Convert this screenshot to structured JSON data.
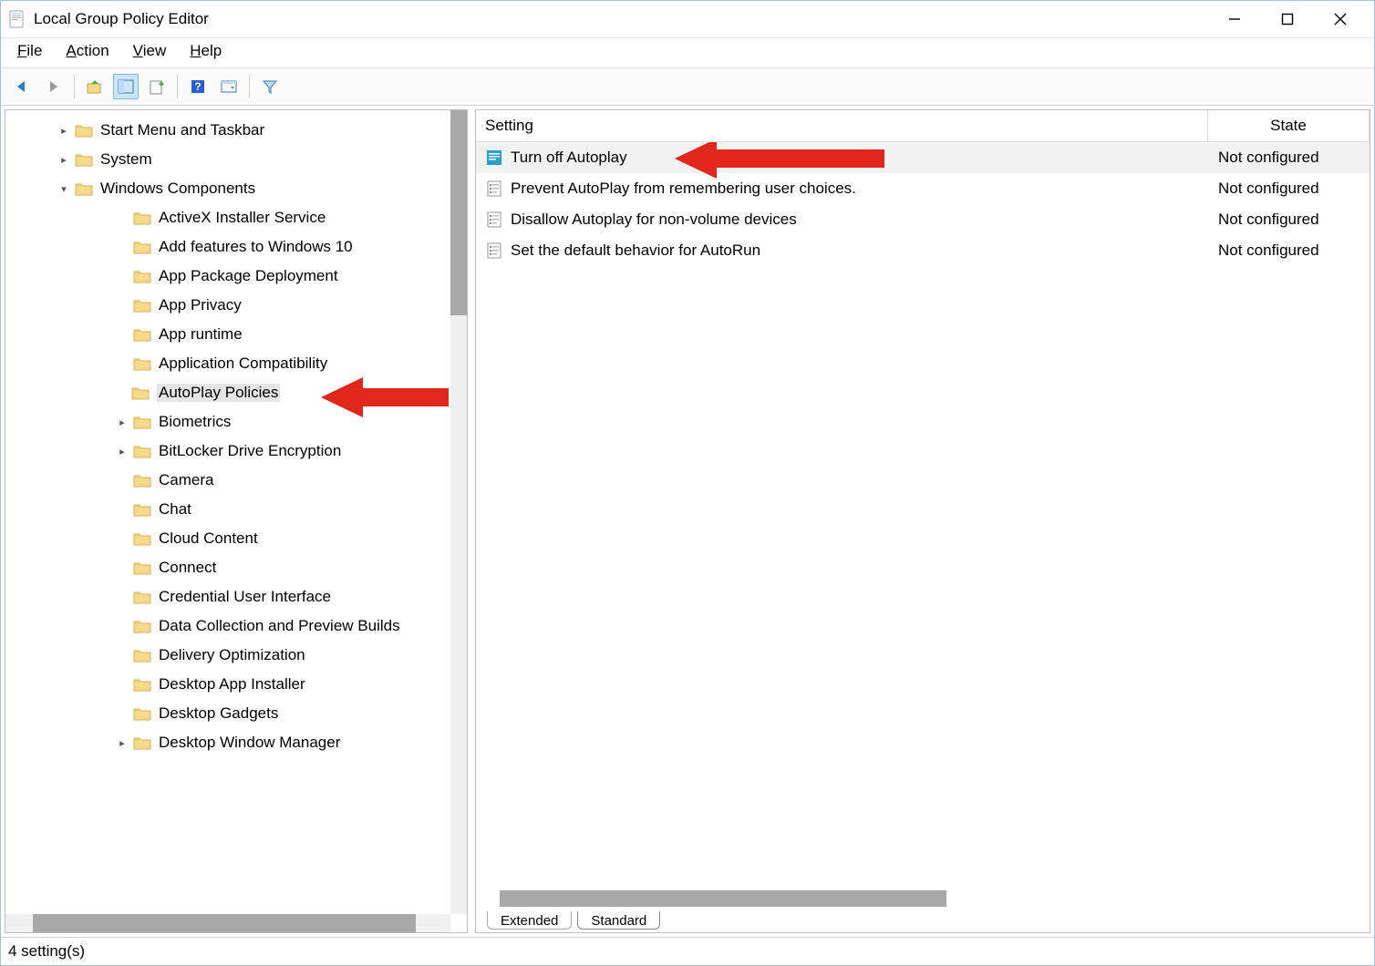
{
  "window": {
    "title": "Local Group Policy Editor"
  },
  "menubar": [
    "File",
    "Action",
    "View",
    "Help"
  ],
  "columns": {
    "setting": "Setting",
    "state": "State"
  },
  "tree": [
    {
      "label": "Start Menu and Taskbar",
      "level": 0,
      "expander": "›"
    },
    {
      "label": "System",
      "level": 0,
      "expander": "›"
    },
    {
      "label": "Windows Components",
      "level": 0,
      "expander": "⌄"
    },
    {
      "label": "ActiveX Installer Service",
      "level": 1
    },
    {
      "label": "Add features to Windows 10",
      "level": 1
    },
    {
      "label": "App Package Deployment",
      "level": 1
    },
    {
      "label": "App Privacy",
      "level": 1
    },
    {
      "label": "App runtime",
      "level": 1
    },
    {
      "label": "Application Compatibility",
      "level": 1
    },
    {
      "label": "AutoPlay Policies",
      "level": 1,
      "selected": true,
      "indent_sel": true
    },
    {
      "label": "Biometrics",
      "level": 1,
      "expander": "›",
      "exp_indent": true
    },
    {
      "label": "BitLocker Drive Encryption",
      "level": 1,
      "expander": "›",
      "exp_indent": true
    },
    {
      "label": "Camera",
      "level": 1
    },
    {
      "label": "Chat",
      "level": 1
    },
    {
      "label": "Cloud Content",
      "level": 1
    },
    {
      "label": "Connect",
      "level": 1
    },
    {
      "label": "Credential User Interface",
      "level": 1
    },
    {
      "label": "Data Collection and Preview Builds",
      "level": 1
    },
    {
      "label": "Delivery Optimization",
      "level": 1
    },
    {
      "label": "Desktop App Installer",
      "level": 1
    },
    {
      "label": "Desktop Gadgets",
      "level": 1
    },
    {
      "label": "Desktop Window Manager",
      "level": 1,
      "expander": "›",
      "exp_indent": true
    }
  ],
  "settings": [
    {
      "name": "Turn off Autoplay",
      "state": "Not configured",
      "selected": true,
      "iconType": "policy-selected"
    },
    {
      "name": "Prevent AutoPlay from remembering user choices.",
      "state": "Not configured"
    },
    {
      "name": "Disallow Autoplay for non-volume devices",
      "state": "Not configured"
    },
    {
      "name": "Set the default behavior for AutoRun",
      "state": "Not configured"
    }
  ],
  "tabs": {
    "extended": "Extended",
    "standard": "Standard"
  },
  "statusbar": "4 setting(s)"
}
